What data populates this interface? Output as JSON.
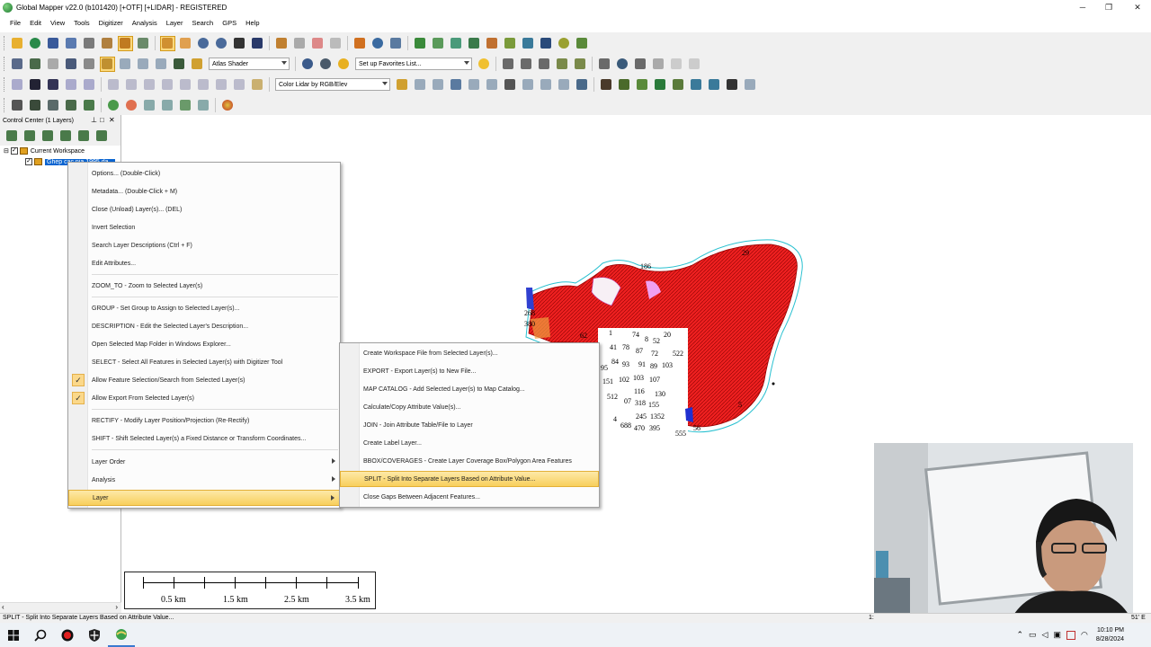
{
  "window": {
    "title": "Global Mapper v22.0 (b101420) [+OTF] [+LIDAR] - REGISTERED",
    "minimize": "─",
    "restore": "❐",
    "close": "✕"
  },
  "menubar": [
    "File",
    "Edit",
    "View",
    "Tools",
    "Digitizer",
    "Analysis",
    "Layer",
    "Search",
    "GPS",
    "Help"
  ],
  "toolbar": {
    "shader_value": "Atlas Shader",
    "favorites_value": "Set up Favorites List...",
    "lidar_color_value": "Color Lidar by RGB/Elev"
  },
  "control_center": {
    "title": "Control Center (1 Layers)",
    "pin": "⊥",
    "float": "□",
    "close": "✕",
    "workspace": "Current Workspace",
    "layer": "Ghep cac nia 1995 da..."
  },
  "context_menu": {
    "items": [
      {
        "label": "Options... (Double-Click)"
      },
      {
        "label": "Metadata... (Double-Click + M)"
      },
      {
        "label": "Close (Unload) Layer(s)... (DEL)"
      },
      {
        "label": "Invert Selection"
      },
      {
        "label": "Search Layer Descriptions (Ctrl + F)"
      },
      {
        "label": "Edit Attributes..."
      },
      {
        "label": "ZOOM_TO - Zoom to Selected Layer(s)"
      },
      {
        "label": "GROUP - Set Group to Assign to Selected Layer(s)..."
      },
      {
        "label": "DESCRIPTION - Edit the Selected Layer's Description..."
      },
      {
        "label": "Open Selected Map Folder in Windows Explorer..."
      },
      {
        "label": "SELECT - Select All Features in Selected Layer(s) with Digitizer Tool"
      },
      {
        "label": "Allow Feature Selection/Search from Selected Layer(s)"
      },
      {
        "label": "Allow Export From Selected Layer(s)"
      },
      {
        "label": "RECTIFY - Modify Layer Position/Projection (Re-Rectify)"
      },
      {
        "label": "SHIFT - Shift Selected Layer(s) a Fixed Distance or Transform Coordinates..."
      },
      {
        "label": "Layer Order"
      },
      {
        "label": "Analysis"
      },
      {
        "label": "Layer"
      }
    ],
    "check": "✓"
  },
  "submenu": {
    "items": [
      {
        "label": "Create Workspace File from Selected Layer(s)..."
      },
      {
        "label": "EXPORT - Export Layer(s) to New File..."
      },
      {
        "label": "MAP CATALOG - Add Selected Layer(s) to Map Catalog..."
      },
      {
        "label": "Calculate/Copy Attribute Value(s)..."
      },
      {
        "label": "JOIN - Join Attribute Table/File to Layer"
      },
      {
        "label": "Create Label Layer..."
      },
      {
        "label": "BBOX/COVERAGES - Create Layer Coverage Box/Polygon Area Features"
      },
      {
        "label": "SPLIT - Split Into Separate Layers Based on Attribute Value..."
      },
      {
        "label": "Close Gaps Between Adjacent Features..."
      }
    ]
  },
  "map": {
    "labels": [
      "186",
      "29",
      "268",
      "380",
      "62",
      "1",
      "74",
      "8",
      "52",
      "20",
      "41",
      "78",
      "87",
      "72",
      "95",
      "84",
      "93",
      "91",
      "89",
      "103",
      "522",
      "151",
      "102",
      "103",
      "107",
      "512",
      "116",
      "130",
      "07",
      "318",
      "155",
      "4",
      "245",
      "1352",
      "688",
      "470",
      "395",
      "555",
      "5",
      "56"
    ]
  },
  "scalebar": {
    "labels": [
      "0.5 km",
      "1.5 km",
      "2.5 km",
      "3.5 km"
    ]
  },
  "statusbar": {
    "text": "SPLIT - Split Into Separate Layers Based on Attribute Value...",
    "right_fragment": "1:",
    "right_fragment2": "51' E"
  },
  "taskbar": {
    "time": "10:10 PM",
    "date": "8/28/2024"
  }
}
